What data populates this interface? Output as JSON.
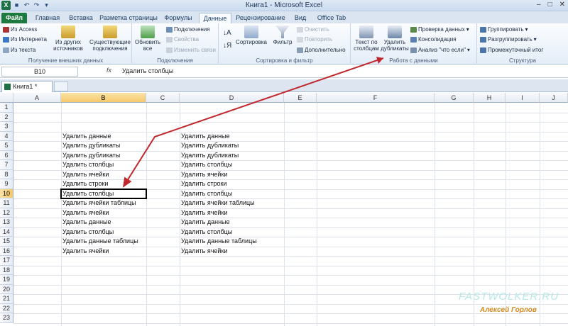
{
  "app": {
    "title": "Книга1 - Microsoft Excel",
    "win_min": "–",
    "win_max": "□",
    "win_close": "✕"
  },
  "tabs": [
    "Файл",
    "Главная",
    "Вставка",
    "Разметка страницы",
    "Формулы",
    "Данные",
    "Рецензирование",
    "Вид",
    "Office Tab"
  ],
  "ribbon": {
    "ext": {
      "label": "Получение внешних данных",
      "access": "Из Access",
      "web": "Из Интернета",
      "text": "Из текста",
      "other": "Из других источников",
      "existing": "Существующие подключения"
    },
    "conn": {
      "label": "Подключения",
      "refresh": "Обновить все",
      "connections": "Подключения",
      "props": "Свойства",
      "edit_links": "Изменить связи"
    },
    "sort": {
      "label": "Сортировка и фильтр",
      "sort": "Сортировка",
      "filter": "Фильтр",
      "clear": "Очистить",
      "reapply": "Повторить",
      "advanced": "Дополнительно"
    },
    "tools": {
      "label": "Работа с данными",
      "text_to_cols": "Текст по столбцам",
      "remove_dups": "Удалить дубликаты",
      "validation": "Проверка данных",
      "consolidate": "Консолидация",
      "whatif": "Анализ \"что если\""
    },
    "outline": {
      "label": "Структура",
      "group": "Группировать",
      "ungroup": "Разгруппировать",
      "subtotal": "Промежуточный итог"
    }
  },
  "formula_bar": {
    "name_box": "B10",
    "fx": "fx",
    "value": "Удалить столбцы"
  },
  "workbook_tab": "Книга1 *",
  "columns": [
    "A",
    "B",
    "C",
    "D",
    "E",
    "F",
    "G",
    "H",
    "I",
    "J"
  ],
  "rows": [
    "1",
    "2",
    "3",
    "4",
    "5",
    "6",
    "7",
    "8",
    "9",
    "10",
    "11",
    "12",
    "13",
    "14",
    "15",
    "16",
    "17",
    "18",
    "19",
    "20",
    "21",
    "22",
    "23"
  ],
  "col_b": [
    "",
    "",
    "",
    "Удалить данные",
    "Удалить дубликаты",
    "Удалить дубликаты",
    "Удалить столбцы",
    "Удалить ячейки",
    "Удалить строки",
    "Удалить столбцы",
    "Удалить ячейки таблицы",
    "Удалить ячейки",
    "Удалить данные",
    "Удалить столбцы",
    "Удалить данные таблицы",
    "Удалить ячейки"
  ],
  "col_d": [
    "",
    "",
    "",
    "Удалить данные",
    "Удалить дубликаты",
    "Удалить дубликаты",
    "Удалить столбцы",
    "Удалить ячейки",
    "Удалить строки",
    "Удалить столбцы",
    "Удалить ячейки таблицы",
    "Удалить ячейки",
    "Удалить данные",
    "Удалить столбцы",
    "Удалить данные таблицы",
    "Удалить ячейки"
  ],
  "selected_cell": "B10",
  "watermark": {
    "site": "FASTWOLKER.RU",
    "author": "Алексей Горлов"
  },
  "colors": {
    "accent": "#1f7a3f",
    "arrow": "#c0282e",
    "selection": "#000000"
  }
}
